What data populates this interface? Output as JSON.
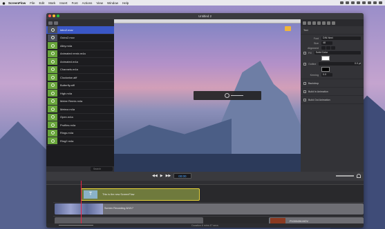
{
  "menubar": {
    "app": "ScreenFlow",
    "items": [
      "File",
      "Edit",
      "Mark",
      "Insert",
      "Font",
      "Actions",
      "View",
      "Window",
      "Help"
    ]
  },
  "window": {
    "title": "Untitled 2"
  },
  "media_list": [
    {
      "label": "intro2.mov",
      "kind": "video",
      "selected": true
    },
    {
      "label": "Outro2.mov",
      "kind": "video"
    },
    {
      "label": "Alley.m4a",
      "kind": "audio"
    },
    {
      "label": "Animated remix.m4a",
      "kind": "audio"
    },
    {
      "label": "Animated.m4a",
      "kind": "audio"
    },
    {
      "label": "Channels.m4a",
      "kind": "audio"
    },
    {
      "label": "Clockwise.aiff",
      "kind": "audio"
    },
    {
      "label": "Butterfly.aiff",
      "kind": "audio"
    },
    {
      "label": "High.m4a",
      "kind": "audio"
    },
    {
      "label": "Melee Remix.m4a",
      "kind": "audio"
    },
    {
      "label": "Meteor.m4a",
      "kind": "audio"
    },
    {
      "label": "Open.m4a",
      "kind": "audio"
    },
    {
      "label": "Profiles.m4a",
      "kind": "audio"
    },
    {
      "label": "Rings.m4a",
      "kind": "audio"
    },
    {
      "label": "Ring2.m4a",
      "kind": "audio"
    }
  ],
  "props": {
    "section": "Text",
    "font_label": "Font",
    "font_value": "DIN Next",
    "size_label": "Size",
    "size_value": "48",
    "alignment_label": "Alignment",
    "fill_label": "Fill",
    "fill_value": "Solid Color",
    "outline_label": "Outline",
    "outline_value": "0.0 pt",
    "kerning_label": "Kerning",
    "kerning_value": "0.0",
    "backdrop_label": "Backdrop",
    "build_in_label": "Build In Animation",
    "build_out_label": "Build Out Animation"
  },
  "transport": {
    "timecode": "00:00"
  },
  "timeline": {
    "text_clip": "This is the new ScreenFlow",
    "text_clip_icon": "T",
    "recording_clip": "Screen Recording 8/4/17",
    "fx_clip": "P1000436.MOV",
    "status": "Duration 8 mins 47 secs"
  },
  "colors": {
    "selection": "#3a57c6",
    "audio_thumb": "#68a53b",
    "playhead": "#e22244",
    "text_clip_border": "#e7d23a"
  }
}
